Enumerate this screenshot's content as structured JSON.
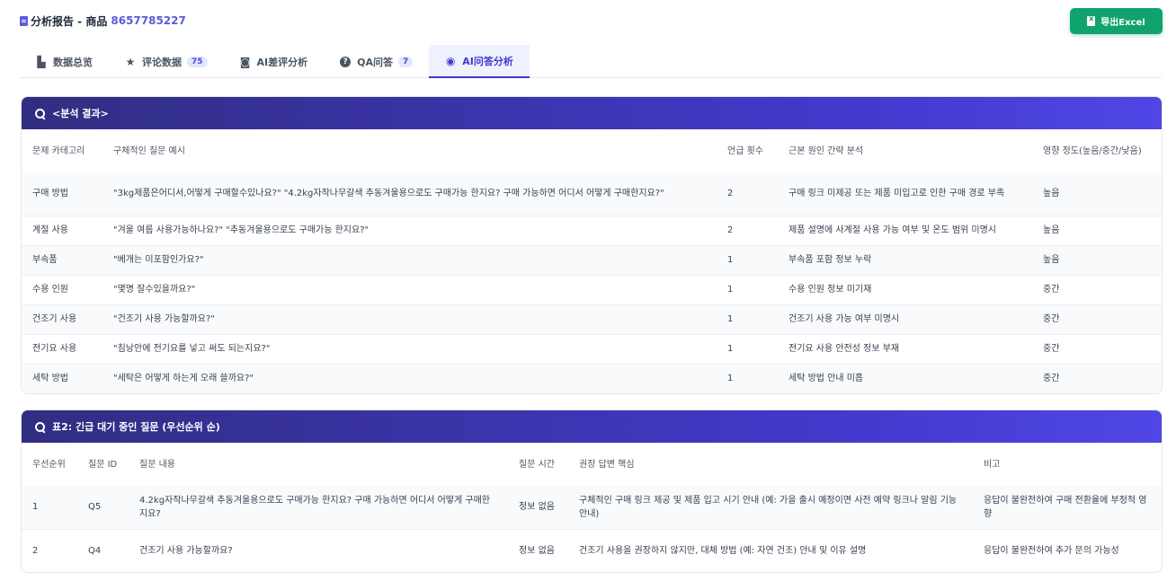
{
  "header": {
    "title": "分析报告 - 商品",
    "product_id": "8657785227",
    "export_label": "导出Excel"
  },
  "tabs": [
    {
      "label": "数据总览",
      "icon": "bar-chart-icon",
      "badge": ""
    },
    {
      "label": "评论数据",
      "icon": "star-icon",
      "badge": "75"
    },
    {
      "label": "AI差评分析",
      "icon": "robot-icon",
      "badge": ""
    },
    {
      "label": "QA问答",
      "icon": "question-icon",
      "badge": "7"
    },
    {
      "label": "AI问答分析",
      "icon": "brain-icon",
      "badge": ""
    }
  ],
  "active_tab": 4,
  "table1": {
    "title": "<분석 결과>",
    "headers": [
      "문제 카테고리",
      "구체적인 질문 예시",
      "언급 횟수",
      "근본 원인 간략 분석",
      "영향 정도(높음/중간/낮음)"
    ],
    "rows": [
      [
        "구매 방법",
        "\"3kg제품은어디서,어떻게 구매할수있나요?\" \"4.2kg자작나무갈색 추동겨울용으로도 구매가능 한지요? 구매 가능하면 어디서 어떻게 구매한지요?\"",
        "2",
        "구매 링크 미제공 또는 제품 미입고로 인한 구매 경로 부족",
        "높음"
      ],
      [
        "계절 사용",
        "\"겨울 여름 사용가능하나요?\" \"추동겨울용으로도 구매가능 한지요?\"",
        "2",
        "제품 설명에 사계절 사용 가능 여부 및 온도 범위 미명시",
        "높음"
      ],
      [
        "부속품",
        "\"베개는 미포함인가요?\"",
        "1",
        "부속품 포함 정보 누락",
        "높음"
      ],
      [
        "수용 인원",
        "\"몇명 잘수있을까요?\"",
        "1",
        "수용 인원 정보 미기재",
        "중간"
      ],
      [
        "건조기 사용",
        "\"건조기 사용 가능할까요?\"",
        "1",
        "건조기 사용 가능 여부 미명시",
        "중간"
      ],
      [
        "전기요 사용",
        "\"침낭안에 전기요를 넣고 써도 되는지요?\"",
        "1",
        "전기요 사용 안전성 정보 부재",
        "중간"
      ],
      [
        "세탁 방법",
        "\"세탁은 어떻게 하는게 오래 쓸까요?\"",
        "1",
        "세탁 방법 안내 미흡",
        "중간"
      ]
    ]
  },
  "table2": {
    "title": "표2: 긴급 대기 중인 질문 (우선순위 순)",
    "headers": [
      "우선순위",
      "질문 ID",
      "질문 내용",
      "질문 시간",
      "권장 답변 핵심",
      "비고"
    ],
    "rows": [
      [
        "1",
        "Q5",
        "4.2kg자작나무갈색 추동겨울용으로도 구매가능 한지요? 구매 가능하면 어디서 어떻게 구매한지요?",
        "정보 없음",
        "구체적인 구매 링크 제공 및 제품 입고 시기 안내 (예: 가을 출시 예정이면 사전 예약 링크나 알림 기능 안내)",
        "응답이 불완전하여 구매 전환율에 부정적 영향"
      ],
      [
        "2",
        "Q4",
        "건조기 사용 가능할까요?",
        "정보 없음",
        "건조기 사용을 권장하지 않지만, 대체 방법 (예: 자연 건조) 안내 및 이유 설명",
        "응답이 불완전하여 추가 문의 가능성"
      ]
    ]
  }
}
